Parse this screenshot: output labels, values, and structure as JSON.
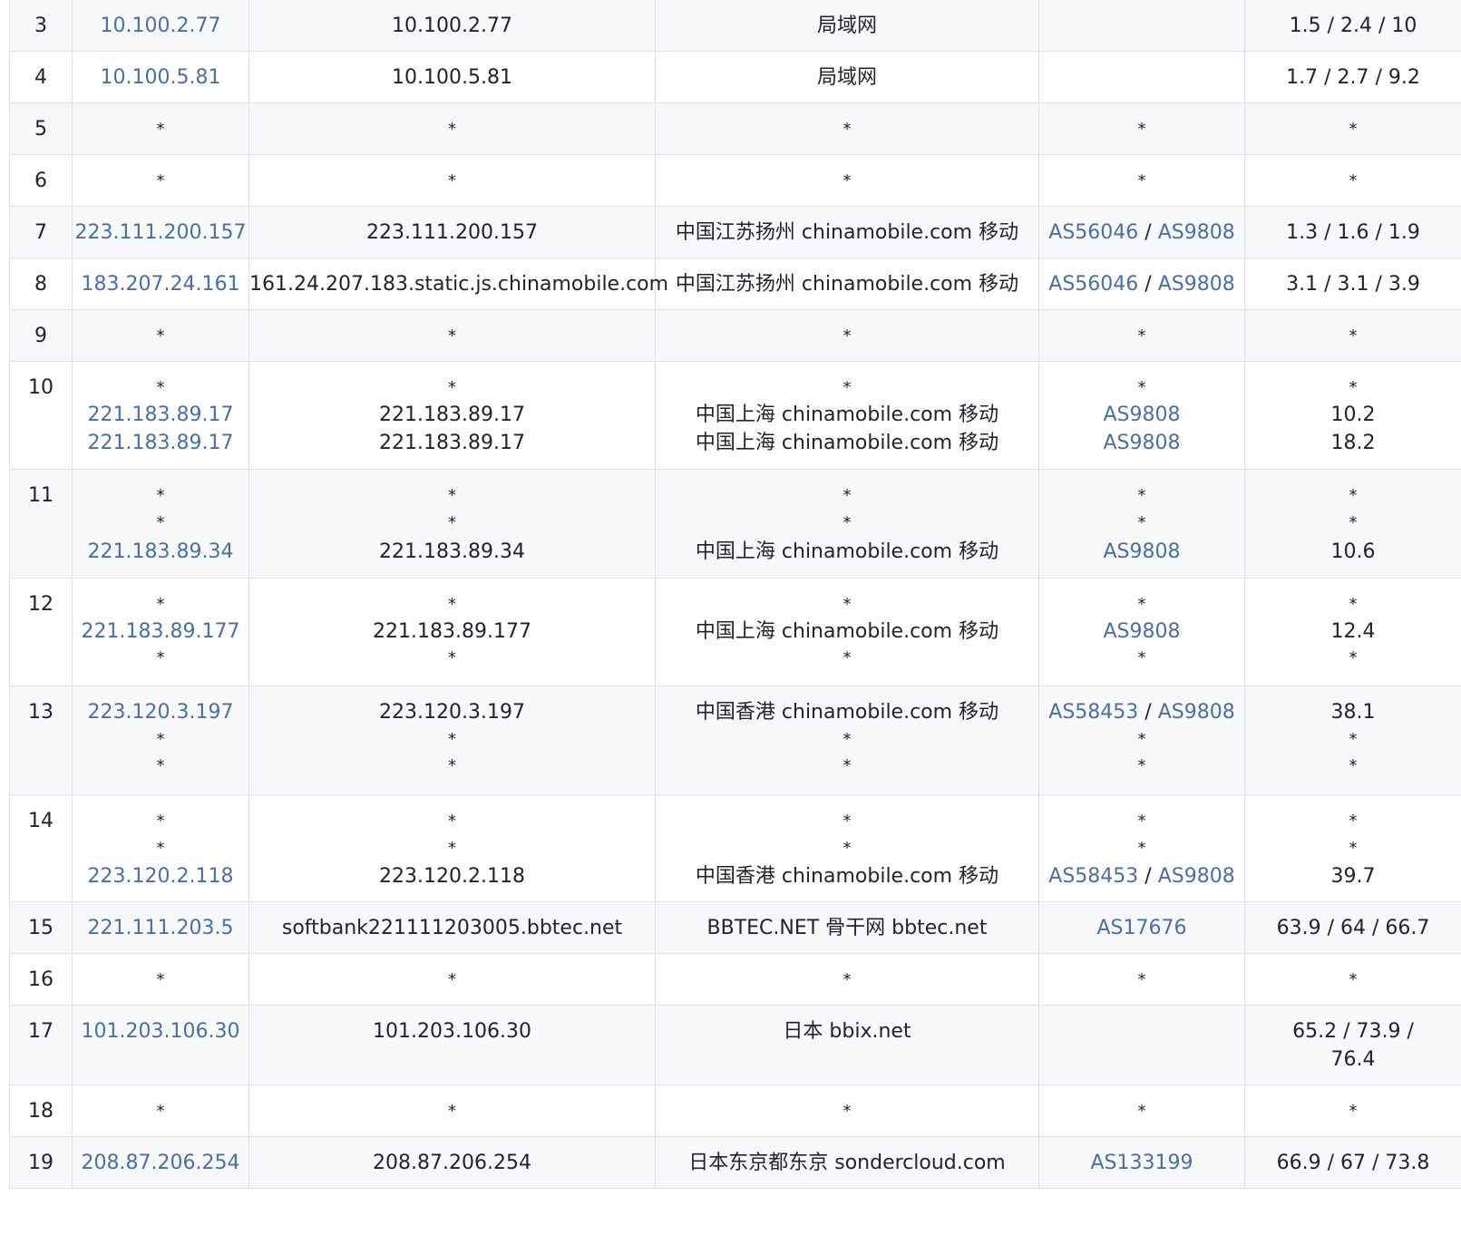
{
  "rows": [
    {
      "hop": "3",
      "ip": [
        "10.100.2.77"
      ],
      "host": [
        "10.100.2.77"
      ],
      "loc": [
        "局域网"
      ],
      "asn": [
        []
      ],
      "rtt": [
        "1.5 / 2.4 / 10"
      ]
    },
    {
      "hop": "4",
      "ip": [
        "10.100.5.81"
      ],
      "host": [
        "10.100.5.81"
      ],
      "loc": [
        "局域网"
      ],
      "asn": [
        []
      ],
      "rtt": [
        "1.7 / 2.7 / 9.2"
      ]
    },
    {
      "hop": "5",
      "ip": [
        "*"
      ],
      "host": [
        "*"
      ],
      "loc": [
        "*"
      ],
      "asn": [
        [
          "*"
        ]
      ],
      "rtt": [
        "*"
      ]
    },
    {
      "hop": "6",
      "ip": [
        "*"
      ],
      "host": [
        "*"
      ],
      "loc": [
        "*"
      ],
      "asn": [
        [
          "*"
        ]
      ],
      "rtt": [
        "*"
      ]
    },
    {
      "hop": "7",
      "ip": [
        "223.111.200.157"
      ],
      "host": [
        "223.111.200.157"
      ],
      "loc": [
        "中国江苏扬州 chinamobile.com 移动"
      ],
      "asn": [
        [
          "AS56046",
          "AS9808"
        ]
      ],
      "rtt": [
        "1.3 / 1.6 / 1.9"
      ]
    },
    {
      "hop": "8",
      "ip": [
        "183.207.24.161"
      ],
      "host": [
        "161.24.207.183.static.js.chinamobile.com"
      ],
      "loc": [
        "中国江苏扬州 chinamobile.com 移动"
      ],
      "asn": [
        [
          "AS56046",
          "AS9808"
        ]
      ],
      "rtt": [
        "3.1 / 3.1 / 3.9"
      ]
    },
    {
      "hop": "9",
      "ip": [
        "*"
      ],
      "host": [
        "*"
      ],
      "loc": [
        "*"
      ],
      "asn": [
        [
          "*"
        ]
      ],
      "rtt": [
        "*"
      ]
    },
    {
      "hop": "10",
      "ip": [
        "*",
        "221.183.89.17",
        "221.183.89.17"
      ],
      "host": [
        "*",
        "221.183.89.17",
        "221.183.89.17"
      ],
      "loc": [
        "*",
        "中国上海 chinamobile.com 移动",
        "中国上海 chinamobile.com 移动"
      ],
      "asn": [
        [
          "*"
        ],
        [
          "AS9808"
        ],
        [
          "AS9808"
        ]
      ],
      "rtt": [
        "*",
        "10.2",
        "18.2"
      ]
    },
    {
      "hop": "11",
      "ip": [
        "*",
        "*",
        "221.183.89.34"
      ],
      "host": [
        "*",
        "*",
        "221.183.89.34"
      ],
      "loc": [
        "*",
        "*",
        "中国上海 chinamobile.com 移动"
      ],
      "asn": [
        [
          "*"
        ],
        [
          "*"
        ],
        [
          "AS9808"
        ]
      ],
      "rtt": [
        "*",
        "*",
        "10.6"
      ]
    },
    {
      "hop": "12",
      "ip": [
        "*",
        "221.183.89.177",
        "*"
      ],
      "host": [
        "*",
        "221.183.89.177",
        "*"
      ],
      "loc": [
        "*",
        "中国上海 chinamobile.com 移动",
        "*"
      ],
      "asn": [
        [
          "*"
        ],
        [
          "AS9808"
        ],
        [
          "*"
        ]
      ],
      "rtt": [
        "*",
        "12.4",
        "*"
      ]
    },
    {
      "hop": "13",
      "ip": [
        "223.120.3.197",
        "*",
        "*"
      ],
      "host": [
        "223.120.3.197",
        "*",
        "*"
      ],
      "loc": [
        "中国香港 chinamobile.com 移动",
        "*",
        "*"
      ],
      "asn": [
        [
          "AS58453",
          "AS9808"
        ],
        [
          "*"
        ],
        [
          "*"
        ]
      ],
      "rtt": [
        "38.1",
        "*",
        "*"
      ]
    },
    {
      "hop": "14",
      "ip": [
        "*",
        "*",
        "223.120.2.118"
      ],
      "host": [
        "*",
        "*",
        "223.120.2.118"
      ],
      "loc": [
        "*",
        "*",
        "中国香港 chinamobile.com 移动"
      ],
      "asn": [
        [
          "*"
        ],
        [
          "*"
        ],
        [
          "AS58453",
          "AS9808"
        ]
      ],
      "rtt": [
        "*",
        "*",
        "39.7"
      ]
    },
    {
      "hop": "15",
      "ip": [
        "221.111.203.5"
      ],
      "host": [
        "softbank221111203005.bbtec.net"
      ],
      "loc": [
        "BBTEC.NET 骨干网 bbtec.net"
      ],
      "asn": [
        [
          "AS17676"
        ]
      ],
      "rtt": [
        "63.9 / 64 / 66.7"
      ]
    },
    {
      "hop": "16",
      "ip": [
        "*"
      ],
      "host": [
        "*"
      ],
      "loc": [
        "*"
      ],
      "asn": [
        [
          "*"
        ]
      ],
      "rtt": [
        "*"
      ]
    },
    {
      "hop": "17",
      "ip": [
        "101.203.106.30"
      ],
      "host": [
        "101.203.106.30"
      ],
      "loc": [
        "日本 bbix.net"
      ],
      "asn": [
        []
      ],
      "rtt": [
        "65.2 / 73.9 /",
        "76.4"
      ]
    },
    {
      "hop": "18",
      "ip": [
        "*"
      ],
      "host": [
        "*"
      ],
      "loc": [
        "*"
      ],
      "asn": [
        [
          "*"
        ]
      ],
      "rtt": [
        "*"
      ]
    },
    {
      "hop": "19",
      "ip": [
        "208.87.206.254"
      ],
      "host": [
        "208.87.206.254"
      ],
      "loc": [
        "日本东京都东京 sondercloud.com"
      ],
      "asn": [
        [
          "AS133199"
        ]
      ],
      "rtt": [
        "66.9 / 67 / 73.8"
      ]
    }
  ]
}
